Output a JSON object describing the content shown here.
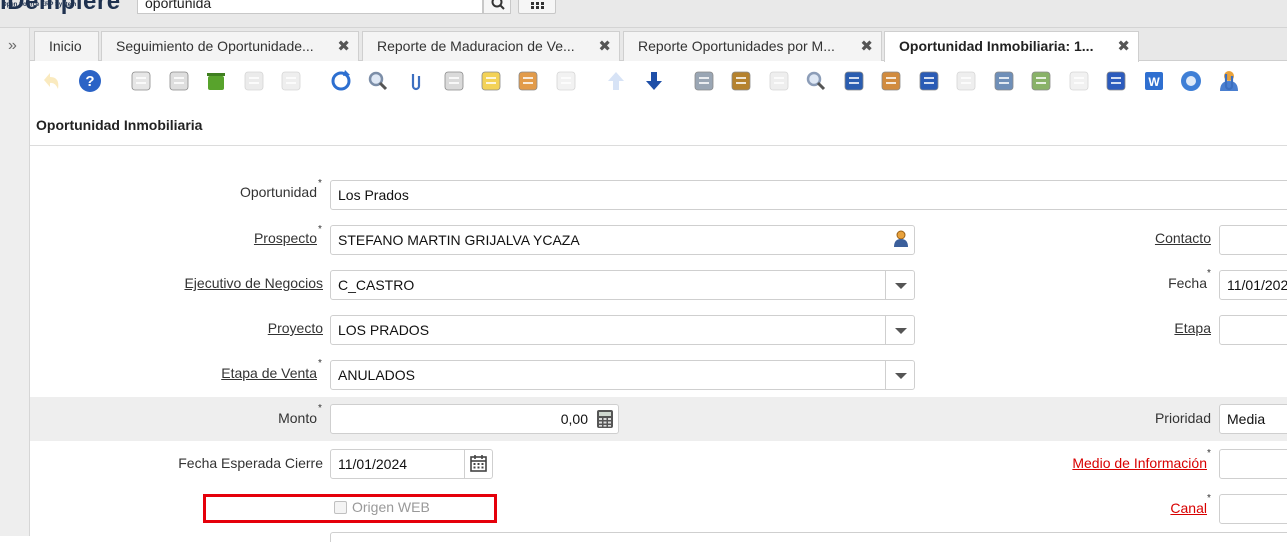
{
  "header": {
    "logo_main": "iDempiere",
    "logo_sub": "Open Source ERP System",
    "search_value": "oportunida"
  },
  "tabs": [
    {
      "label": "Inicio"
    },
    {
      "label": "Seguimiento de Oportunidade..."
    },
    {
      "label": "Reporte de Maduracion de Ve..."
    },
    {
      "label": "Reporte Oportunidades por M..."
    },
    {
      "label": "Oportunidad Inmobiliaria: 1..."
    }
  ],
  "tab_close_glyph": "✖",
  "toolbar_icons": [
    "undo-icon",
    "help-icon",
    "new-record-icon",
    "copy-record-icon",
    "delete-icon",
    "save-icon",
    "save-new-icon",
    "refresh-icon",
    "find-icon",
    "attachment-icon",
    "chat-icon",
    "post-it-icon",
    "grid-toggle-icon",
    "multi-edit-icon",
    "parent-record-icon",
    "detail-record-icon",
    "report-icon",
    "archive-icon",
    "print-icon",
    "zoom-across-icon",
    "active-workflows-icon",
    "requests-icon",
    "product-info-icon",
    "lock-icon",
    "process-icon",
    "export-icon",
    "import-icon",
    "quick-form-icon",
    "word-export-icon",
    "web-icon",
    "user-info-icon",
    "attachment-2-icon"
  ],
  "window_title": "Oportunidad Inmobiliaria",
  "form": {
    "oportunidad_label": "Oportunidad",
    "oportunidad_value": "Los Prados",
    "prospecto_label": "Prospecto",
    "prospecto_value": "STEFANO MARTIN GRIJALVA YCAZA",
    "contacto_label": "Contacto",
    "ejecutivo_label": "Ejecutivo de Negocios",
    "ejecutivo_value": "C_CASTRO",
    "fecha_label": "Fecha",
    "fecha_value": "11/01/202",
    "proyecto_label": "Proyecto",
    "proyecto_value": "LOS PRADOS",
    "etapa_label": "Etapa",
    "etapa_venta_label": "Etapa de Venta",
    "etapa_venta_value": "ANULADOS",
    "monto_label": "Monto",
    "monto_value": "0,00",
    "prioridad_label": "Prioridad",
    "prioridad_value": "Media",
    "fecha_cierre_label": "Fecha Esperada Cierre",
    "fecha_cierre_value": "11/01/2024",
    "medio_label": "Medio de Información",
    "origen_web_label": "Origen WEB",
    "canal_label": "Canal",
    "required_mark": "*"
  },
  "colors": {
    "highlight_box": "#e5000b",
    "mandatory_label": "#d80000"
  }
}
